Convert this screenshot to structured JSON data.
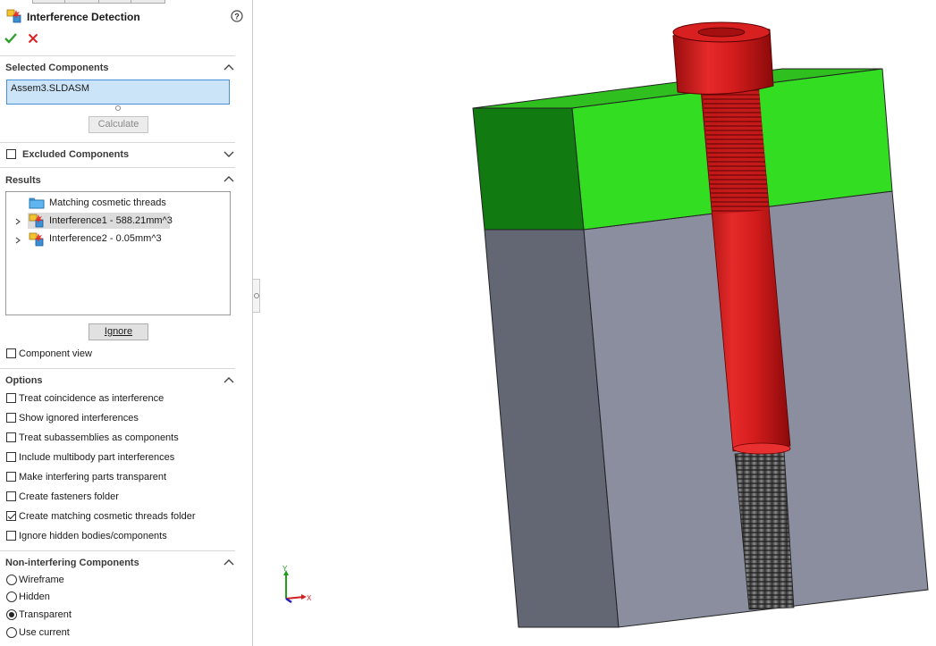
{
  "panel": {
    "title": "Interference Detection",
    "help_icon": "help-circle-icon",
    "ok_icon": "check-icon",
    "cancel_icon": "x-icon",
    "selected_components": {
      "header": "Selected Components",
      "items": [
        "Assem3.SLDASM"
      ],
      "calculate_button": "Calculate"
    },
    "excluded_components": {
      "label": "Excluded Components",
      "checked": false
    },
    "results": {
      "header": "Results",
      "items": [
        {
          "icon": "folder-icon",
          "label": "Matching cosmetic threads",
          "expandable": false,
          "selected": false
        },
        {
          "icon": "interference-icon",
          "label": "Interference1 - 588.21mm^3",
          "expandable": true,
          "selected": true
        },
        {
          "icon": "interference-icon",
          "label": "Interference2 - 0.05mm^3",
          "expandable": true,
          "selected": false
        }
      ],
      "ignore_button": "Ignore"
    },
    "component_view": {
      "label": "Component view",
      "checked": false
    },
    "options": {
      "header": "Options",
      "items": [
        {
          "label": "Treat coincidence as interference",
          "checked": false
        },
        {
          "label": "Show ignored interferences",
          "checked": false
        },
        {
          "label": "Treat subassemblies as components",
          "checked": false
        },
        {
          "label": "Include multibody part interferences",
          "checked": false
        },
        {
          "label": "Make interfering parts transparent",
          "checked": false
        },
        {
          "label": "Create fasteners folder",
          "checked": false
        },
        {
          "label": "Create matching cosmetic threads folder",
          "checked": true
        },
        {
          "label": "Ignore hidden bodies/components",
          "checked": false
        }
      ]
    },
    "non_interfering": {
      "header": "Non-interfering Components",
      "items": [
        {
          "label": "Wireframe",
          "checked": false
        },
        {
          "label": "Hidden",
          "checked": false
        },
        {
          "label": "Transparent",
          "checked": true
        },
        {
          "label": "Use current",
          "checked": false
        }
      ]
    }
  },
  "viewport": {
    "triad": {
      "y_label": "Y",
      "x_label": "X"
    },
    "colors": {
      "top_block": "#33dd22",
      "bottom_block": "#8a8e9e",
      "bolt": "#dd1a1a",
      "thread": "#555555"
    }
  }
}
